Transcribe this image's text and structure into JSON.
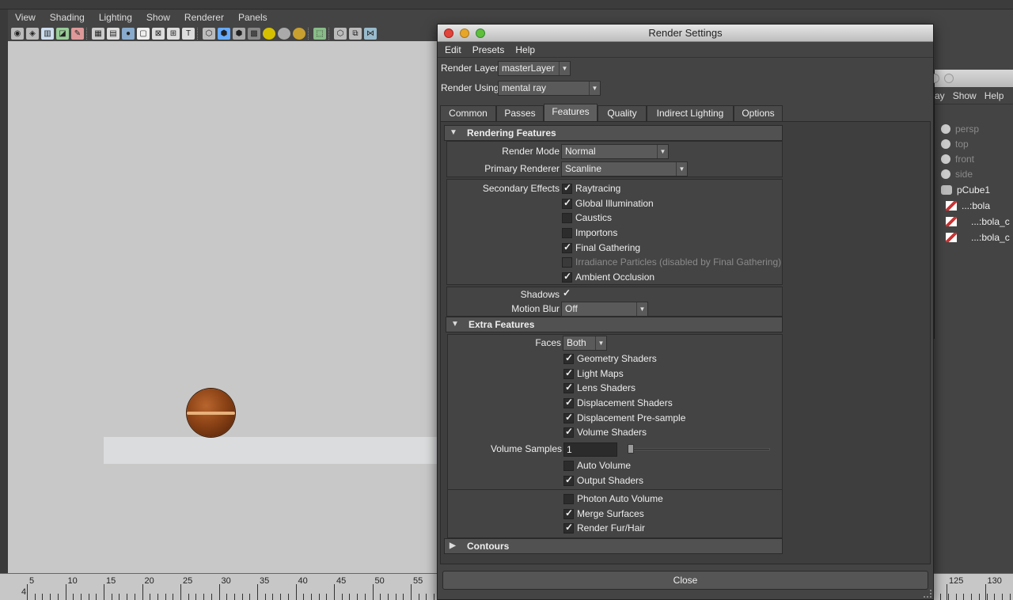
{
  "viewport": {
    "menu": [
      "View",
      "Shading",
      "Lighting",
      "Show",
      "Renderer",
      "Panels"
    ]
  },
  "timeline": {
    "current_frame": "4",
    "ticks": [
      "5",
      "10",
      "15",
      "20",
      "25",
      "30",
      "35",
      "40",
      "45",
      "50",
      "55"
    ],
    "right_ticks": [
      "125",
      "130"
    ]
  },
  "outliner": {
    "menu": [
      "ay",
      "Show",
      "Help"
    ],
    "items": [
      "persp",
      "top",
      "front",
      "side",
      "pCube1",
      "...:bola",
      "...:bola_c",
      "...:bola_c"
    ]
  },
  "render_settings": {
    "title": "Render Settings",
    "menu": [
      "Edit",
      "Presets",
      "Help"
    ],
    "render_layer_label": "Render Layer",
    "render_layer_value": "masterLayer",
    "render_using_label": "Render Using",
    "render_using_value": "mental ray",
    "tabs": [
      "Common",
      "Passes",
      "Features",
      "Quality",
      "Indirect Lighting",
      "Options"
    ],
    "active_tab": "Features",
    "rendering_features": {
      "title": "Rendering Features",
      "render_mode_label": "Render Mode",
      "render_mode_value": "Normal",
      "primary_renderer_label": "Primary Renderer",
      "primary_renderer_value": "Scanline",
      "secondary_effects_label": "Secondary Effects",
      "secondary_effects": [
        {
          "label": "Raytracing",
          "checked": true,
          "enabled": true
        },
        {
          "label": "Global Illumination",
          "checked": true,
          "enabled": true
        },
        {
          "label": "Caustics",
          "checked": false,
          "enabled": true
        },
        {
          "label": "Importons",
          "checked": false,
          "enabled": true
        },
        {
          "label": "Final Gathering",
          "checked": true,
          "enabled": true
        },
        {
          "label": "Irradiance Particles (disabled by Final Gathering)",
          "checked": false,
          "enabled": false
        },
        {
          "label": "Ambient Occlusion",
          "checked": true,
          "enabled": true
        }
      ],
      "shadows_label": "Shadows",
      "shadows_checked": true,
      "motion_blur_label": "Motion Blur",
      "motion_blur_value": "Off"
    },
    "extra_features": {
      "title": "Extra Features",
      "faces_label": "Faces",
      "faces_value": "Both",
      "checks": [
        {
          "label": "Geometry Shaders",
          "checked": true
        },
        {
          "label": "Light Maps",
          "checked": true
        },
        {
          "label": "Lens Shaders",
          "checked": true
        },
        {
          "label": "Displacement Shaders",
          "checked": true
        },
        {
          "label": "Displacement Pre-sample",
          "checked": true
        },
        {
          "label": "Volume Shaders",
          "checked": true
        }
      ],
      "volume_samples_label": "Volume Samples",
      "volume_samples_value": "1",
      "checks2": [
        {
          "label": "Auto Volume",
          "checked": false
        },
        {
          "label": "Output Shaders",
          "checked": true
        }
      ],
      "checks3": [
        {
          "label": "Photon Auto Volume",
          "checked": false
        },
        {
          "label": "Merge Surfaces",
          "checked": true
        },
        {
          "label": "Render Fur/Hair",
          "checked": true
        }
      ]
    },
    "contours_title": "Contours",
    "close_label": "Close"
  }
}
